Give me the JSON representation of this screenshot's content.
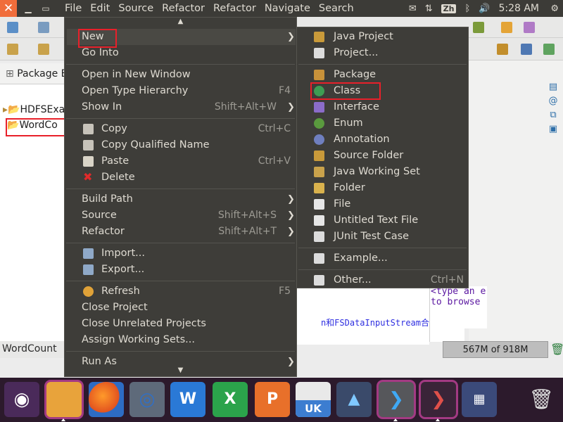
{
  "topbar": {
    "menus": [
      "File",
      "Edit",
      "Source",
      "Refactor",
      "Refactor",
      "Navigate",
      "Search"
    ],
    "tray": {
      "input_method": "Zh",
      "clock": "5:28 AM"
    }
  },
  "package_explorer": {
    "title": "Package E",
    "items": [
      "HDFSExa",
      "WordCo"
    ],
    "status_text": "WordCount"
  },
  "editor": {
    "code_fragment": "n和FSDataInputStream合",
    "hint_line1": "<type an e",
    "hint_line2": "to browse"
  },
  "heap": {
    "text": "567M of 918M"
  },
  "context_menu": {
    "items": [
      {
        "label": "New",
        "shortcut": "",
        "submenu": true
      },
      {
        "label": "Go Into",
        "shortcut": "",
        "submenu": false
      },
      {
        "label": "Open in New Window",
        "shortcut": "",
        "submenu": false
      },
      {
        "label": "Open Type Hierarchy",
        "shortcut": "F4",
        "submenu": false
      },
      {
        "label": "Show In",
        "shortcut": "Shift+Alt+W",
        "submenu": true
      },
      {
        "label": "Copy",
        "shortcut": "Ctrl+C",
        "submenu": false
      },
      {
        "label": "Copy Qualified Name",
        "shortcut": "",
        "submenu": false
      },
      {
        "label": "Paste",
        "shortcut": "Ctrl+V",
        "submenu": false
      },
      {
        "label": "Delete",
        "shortcut": "",
        "submenu": false
      },
      {
        "label": "Build Path",
        "shortcut": "",
        "submenu": true
      },
      {
        "label": "Source",
        "shortcut": "Shift+Alt+S",
        "submenu": true
      },
      {
        "label": "Refactor",
        "shortcut": "Shift+Alt+T",
        "submenu": true
      },
      {
        "label": "Import...",
        "shortcut": "",
        "submenu": false
      },
      {
        "label": "Export...",
        "shortcut": "",
        "submenu": false
      },
      {
        "label": "Refresh",
        "shortcut": "F5",
        "submenu": false
      },
      {
        "label": "Close Project",
        "shortcut": "",
        "submenu": false
      },
      {
        "label": "Close Unrelated Projects",
        "shortcut": "",
        "submenu": false
      },
      {
        "label": "Assign Working Sets...",
        "shortcut": "",
        "submenu": false
      },
      {
        "label": "Run As",
        "shortcut": "",
        "submenu": true
      }
    ]
  },
  "new_submenu": {
    "items": [
      {
        "label": "Java Project",
        "shortcut": ""
      },
      {
        "label": "Project...",
        "shortcut": ""
      },
      {
        "label": "Package",
        "shortcut": ""
      },
      {
        "label": "Class",
        "shortcut": ""
      },
      {
        "label": "Interface",
        "shortcut": ""
      },
      {
        "label": "Enum",
        "shortcut": ""
      },
      {
        "label": "Annotation",
        "shortcut": ""
      },
      {
        "label": "Source Folder",
        "shortcut": ""
      },
      {
        "label": "Java Working Set",
        "shortcut": ""
      },
      {
        "label": "Folder",
        "shortcut": ""
      },
      {
        "label": "File",
        "shortcut": ""
      },
      {
        "label": "Untitled Text File",
        "shortcut": ""
      },
      {
        "label": "JUnit Test Case",
        "shortcut": ""
      },
      {
        "label": "Example...",
        "shortcut": ""
      },
      {
        "label": "Other...",
        "shortcut": "Ctrl+N"
      }
    ]
  },
  "dock": {
    "office_letters": [
      "W",
      "X",
      "P"
    ],
    "badge": "UK"
  },
  "colors": {
    "menu_bg": "#3e3d39",
    "panel_bg": "#3c3b37",
    "accent_orange": "#f06d3b",
    "highlight_red": "#e8202a",
    "dock_bg": "#2c1a2c"
  }
}
